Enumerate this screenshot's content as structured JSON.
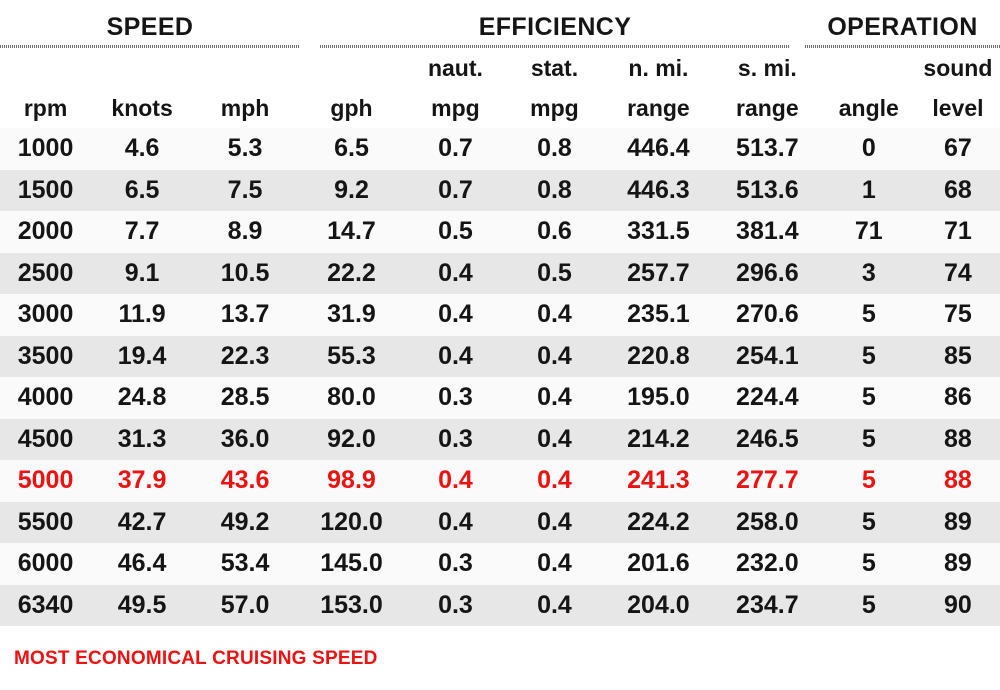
{
  "groups": [
    {
      "label": "SPEED"
    },
    {
      "label": "EFFICIENCY"
    },
    {
      "label": "OPERATION"
    }
  ],
  "columns": [
    {
      "key": "rpm",
      "sub": "",
      "unit": "rpm",
      "group": "SPEED"
    },
    {
      "key": "knots",
      "sub": "",
      "unit": "knots",
      "group": "SPEED"
    },
    {
      "key": "mph",
      "sub": "",
      "unit": "mph",
      "group": "SPEED"
    },
    {
      "key": "gph",
      "sub": "",
      "unit": "gph",
      "group": "EFFICIENCY"
    },
    {
      "key": "n_mpg",
      "sub": "naut.",
      "unit": "mpg",
      "group": "EFFICIENCY"
    },
    {
      "key": "s_mpg",
      "sub": "stat.",
      "unit": "mpg",
      "group": "EFFICIENCY"
    },
    {
      "key": "n_range",
      "sub": "n. mi.",
      "unit": "range",
      "group": "EFFICIENCY"
    },
    {
      "key": "s_range",
      "sub": "s. mi.",
      "unit": "range",
      "group": "EFFICIENCY"
    },
    {
      "key": "angle",
      "sub": "",
      "unit": "angle",
      "group": "OPERATION"
    },
    {
      "key": "level",
      "sub": "sound",
      "unit": "level",
      "group": "OPERATION"
    }
  ],
  "rows": [
    {
      "rpm": "1000",
      "knots": "4.6",
      "mph": "5.3",
      "gph": "6.5",
      "n_mpg": "0.7",
      "s_mpg": "0.8",
      "n_range": "446.4",
      "s_range": "513.7",
      "angle": "0",
      "level": "67",
      "highlight": false
    },
    {
      "rpm": "1500",
      "knots": "6.5",
      "mph": "7.5",
      "gph": "9.2",
      "n_mpg": "0.7",
      "s_mpg": "0.8",
      "n_range": "446.3",
      "s_range": "513.6",
      "angle": "1",
      "level": "68",
      "highlight": false
    },
    {
      "rpm": "2000",
      "knots": "7.7",
      "mph": "8.9",
      "gph": "14.7",
      "n_mpg": "0.5",
      "s_mpg": "0.6",
      "n_range": "331.5",
      "s_range": "381.4",
      "angle": "71",
      "level": "71",
      "highlight": false
    },
    {
      "rpm": "2500",
      "knots": "9.1",
      "mph": "10.5",
      "gph": "22.2",
      "n_mpg": "0.4",
      "s_mpg": "0.5",
      "n_range": "257.7",
      "s_range": "296.6",
      "angle": "3",
      "level": "74",
      "highlight": false
    },
    {
      "rpm": "3000",
      "knots": "11.9",
      "mph": "13.7",
      "gph": "31.9",
      "n_mpg": "0.4",
      "s_mpg": "0.4",
      "n_range": "235.1",
      "s_range": "270.6",
      "angle": "5",
      "level": "75",
      "highlight": false
    },
    {
      "rpm": "3500",
      "knots": "19.4",
      "mph": "22.3",
      "gph": "55.3",
      "n_mpg": "0.4",
      "s_mpg": "0.4",
      "n_range": "220.8",
      "s_range": "254.1",
      "angle": "5",
      "level": "85",
      "highlight": false
    },
    {
      "rpm": "4000",
      "knots": "24.8",
      "mph": "28.5",
      "gph": "80.0",
      "n_mpg": "0.3",
      "s_mpg": "0.4",
      "n_range": "195.0",
      "s_range": "224.4",
      "angle": "5",
      "level": "86",
      "highlight": false
    },
    {
      "rpm": "4500",
      "knots": "31.3",
      "mph": "36.0",
      "gph": "92.0",
      "n_mpg": "0.3",
      "s_mpg": "0.4",
      "n_range": "214.2",
      "s_range": "246.5",
      "angle": "5",
      "level": "88",
      "highlight": false
    },
    {
      "rpm": "5000",
      "knots": "37.9",
      "mph": "43.6",
      "gph": "98.9",
      "n_mpg": "0.4",
      "s_mpg": "0.4",
      "n_range": "241.3",
      "s_range": "277.7",
      "angle": "5",
      "level": "88",
      "highlight": true
    },
    {
      "rpm": "5500",
      "knots": "42.7",
      "mph": "49.2",
      "gph": "120.0",
      "n_mpg": "0.4",
      "s_mpg": "0.4",
      "n_range": "224.2",
      "s_range": "258.0",
      "angle": "5",
      "level": "89",
      "highlight": false
    },
    {
      "rpm": "6000",
      "knots": "46.4",
      "mph": "53.4",
      "gph": "145.0",
      "n_mpg": "0.3",
      "s_mpg": "0.4",
      "n_range": "201.6",
      "s_range": "232.0",
      "angle": "5",
      "level": "89",
      "highlight": false
    },
    {
      "rpm": "6340",
      "knots": "49.5",
      "mph": "57.0",
      "gph": "153.0",
      "n_mpg": "0.3",
      "s_mpg": "0.4",
      "n_range": "204.0",
      "s_range": "234.7",
      "angle": "5",
      "level": "90",
      "highlight": false
    }
  ],
  "footer": {
    "note": "MOST ECONOMICAL CRUISING SPEED"
  },
  "colors": {
    "highlight": "#ee1111",
    "text": "#151515",
    "row_even": "#e7e7e7",
    "row_odd": "#fafafa"
  },
  "chart_data": {
    "type": "table",
    "title": "Boat Performance Data",
    "column_groups": [
      "SPEED",
      "EFFICIENCY",
      "OPERATION"
    ],
    "columns": [
      "rpm",
      "knots",
      "mph",
      "gph",
      "naut. mpg",
      "stat. mpg",
      "n. mi. range",
      "s. mi. range",
      "angle",
      "sound level"
    ],
    "rows": [
      [
        "1000",
        "4.6",
        "5.3",
        "6.5",
        "0.7",
        "0.8",
        "446.4",
        "513.7",
        "0",
        "67"
      ],
      [
        "1500",
        "6.5",
        "7.5",
        "9.2",
        "0.7",
        "0.8",
        "446.3",
        "513.6",
        "1",
        "68"
      ],
      [
        "2000",
        "7.7",
        "8.9",
        "14.7",
        "0.5",
        "0.6",
        "331.5",
        "381.4",
        "71",
        "71"
      ],
      [
        "2500",
        "9.1",
        "10.5",
        "22.2",
        "0.4",
        "0.5",
        "257.7",
        "296.6",
        "3",
        "74"
      ],
      [
        "3000",
        "11.9",
        "13.7",
        "31.9",
        "0.4",
        "0.4",
        "235.1",
        "270.6",
        "5",
        "75"
      ],
      [
        "3500",
        "19.4",
        "22.3",
        "55.3",
        "0.4",
        "0.4",
        "220.8",
        "254.1",
        "5",
        "85"
      ],
      [
        "4000",
        "24.8",
        "28.5",
        "80.0",
        "0.3",
        "0.4",
        "195.0",
        "224.4",
        "5",
        "86"
      ],
      [
        "4500",
        "31.3",
        "36.0",
        "92.0",
        "0.3",
        "0.4",
        "214.2",
        "246.5",
        "5",
        "88"
      ],
      [
        "5000",
        "37.9",
        "43.6",
        "98.9",
        "0.4",
        "0.4",
        "241.3",
        "277.7",
        "5",
        "88"
      ],
      [
        "5500",
        "42.7",
        "49.2",
        "120.0",
        "0.4",
        "0.4",
        "224.2",
        "258.0",
        "5",
        "89"
      ],
      [
        "6000",
        "46.4",
        "53.4",
        "145.0",
        "0.3",
        "0.4",
        "201.6",
        "232.0",
        "5",
        "89"
      ],
      [
        "6340",
        "49.5",
        "57.0",
        "153.0",
        "0.3",
        "0.4",
        "204.0",
        "234.7",
        "5",
        "90"
      ]
    ],
    "highlighted_row_index": 8,
    "highlight_meaning": "MOST ECONOMICAL CRUISING SPEED"
  }
}
